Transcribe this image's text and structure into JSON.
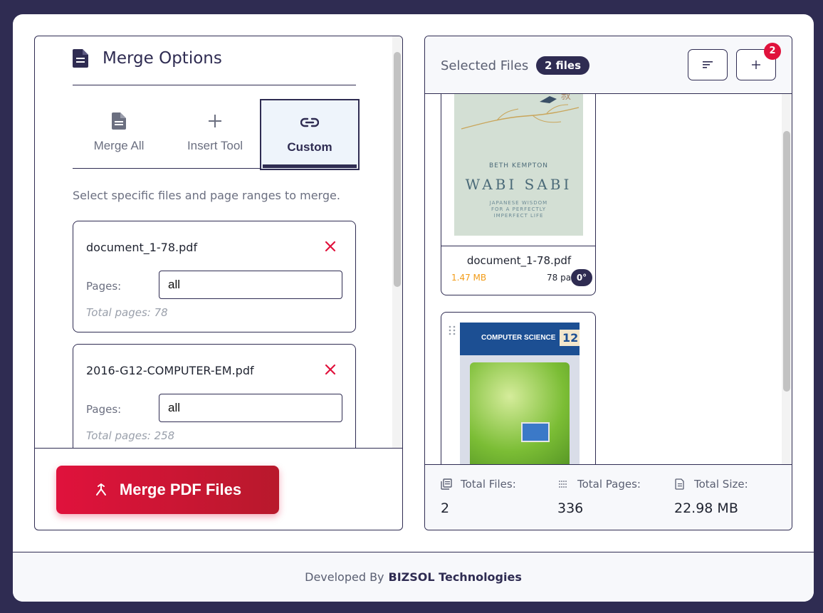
{
  "merge_options": {
    "title": "Merge Options",
    "tabs": [
      {
        "label": "Merge All",
        "icon": "document-icon"
      },
      {
        "label": "Insert Tool",
        "icon": "plus-icon"
      },
      {
        "label": "Custom",
        "icon": "link-icon",
        "active": true
      }
    ],
    "hint": "Select specific files and page ranges to merge.",
    "files": [
      {
        "name": "document_1-78.pdf",
        "pages_label": "Pages:",
        "pages_value": "all",
        "total": "Total pages: 78"
      },
      {
        "name": "2016-G12-COMPUTER-EM.pdf",
        "pages_label": "Pages:",
        "pages_value": "all",
        "total": "Total pages: 258"
      }
    ],
    "merge_button": "Merge PDF Files"
  },
  "selected_files": {
    "title": "Selected Files",
    "count": "2 files",
    "badge": "2",
    "cards": [
      {
        "name": "document_1-78.pdf",
        "size": "1.47 MB",
        "pages": "78 pages",
        "rotation": "0°",
        "cover": {
          "author": "BETH KEMPTON",
          "title": "WABI SABI",
          "subtitle": "JAPANESE WISDOM FOR A PERFECTLY IMPERFECT LIFE"
        }
      },
      {
        "cover": {
          "title": "COMPUTER SCIENCE",
          "grade": "12"
        }
      }
    ],
    "stats": [
      {
        "label": "Total Files:",
        "value": "2"
      },
      {
        "label": "Total Pages:",
        "value": "336"
      },
      {
        "label": "Total Size:",
        "value": "22.98 MB"
      }
    ]
  },
  "footer": {
    "prefix": "Developed By",
    "brand": "BIZSOL Technologies"
  },
  "colors": {
    "primary": "#2f2c52",
    "accent_red": "#e0123c",
    "size_orange": "#f29b16"
  }
}
